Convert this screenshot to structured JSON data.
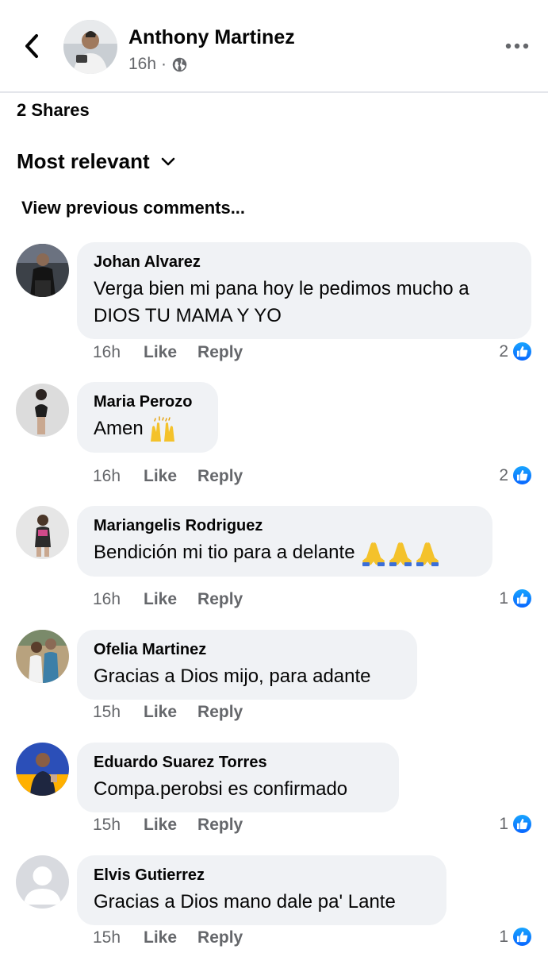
{
  "header": {
    "author_name": "Anthony Martinez",
    "time": "16h",
    "separator": "·",
    "privacy_icon": "globe-icon"
  },
  "post": {
    "shares": "2 Shares"
  },
  "comments_section": {
    "sort_label": "Most relevant",
    "view_previous": "View previous comments..."
  },
  "comments": [
    {
      "name": "Johan Alvarez",
      "text_line1": "Verga bien mi pana hoy le pedimos mucho a",
      "text_line2": "DIOS TU MAMA Y YO",
      "time": "16h",
      "like": "Like",
      "reply": "Reply",
      "reactions": "2"
    },
    {
      "name": "Maria Perozo",
      "text": "Amen",
      "emoji": "raising-hands-emoji",
      "time": "16h",
      "like": "Like",
      "reply": "Reply",
      "reactions": "2"
    },
    {
      "name": "Mariangelis Rodriguez",
      "text": "Bendición mi tio para a delante",
      "emoji": "folded-hands-emoji x3",
      "time": "16h",
      "like": "Like",
      "reply": "Reply",
      "reactions": "1"
    },
    {
      "name": "Ofelia Martinez",
      "text": "Gracias a Dios mijo, para adante",
      "time": "15h",
      "like": "Like",
      "reply": "Reply",
      "reactions": ""
    },
    {
      "name": "Eduardo Suarez Torres",
      "text": "Compa.perobsi es confirmado",
      "time": "15h",
      "like": "Like",
      "reply": "Reply",
      "reactions": "1"
    },
    {
      "name": "Elvis Gutierrez",
      "text": "Gracias a Dios mano dale pa' Lante",
      "time": "15h",
      "like": "Like",
      "reply": "Reply",
      "reactions": "1"
    }
  ],
  "colors": {
    "bubble": "#f0f2f5",
    "secondary_text": "#65676b",
    "like_blue": "#0866ff"
  }
}
